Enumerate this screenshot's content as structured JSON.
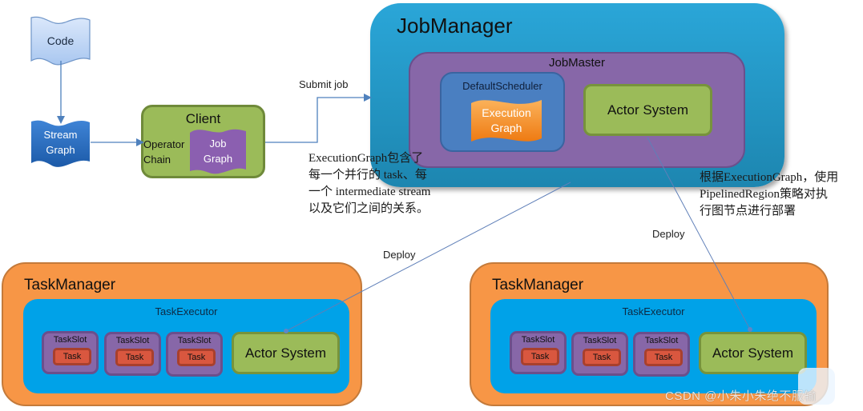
{
  "diagram": {
    "nodes": {
      "code": "Code",
      "stream_graph": [
        "Stream",
        "Graph"
      ],
      "client": {
        "title": "Client",
        "operator_chain": [
          "Operator",
          "Chain"
        ],
        "job_graph": [
          "Job",
          "Graph"
        ]
      },
      "job_manager": {
        "title": "JobManager",
        "job_master": {
          "title": "JobMaster",
          "default_scheduler": {
            "title": "DefaultScheduler",
            "execution_graph": [
              "Execution",
              "Graph"
            ]
          },
          "actor_system": "Actor System"
        }
      },
      "task_managers": [
        {
          "title": "TaskManager",
          "executor": "TaskExecutor",
          "slots": [
            {
              "title": "TaskSlot",
              "task": "Task"
            },
            {
              "title": "TaskSlot",
              "task": "Task"
            },
            {
              "title": "TaskSlot",
              "task": "Task"
            }
          ],
          "actor_system": "Actor System"
        },
        {
          "title": "TaskManager",
          "executor": "TaskExecutor",
          "slots": [
            {
              "title": "TaskSlot",
              "task": "Task"
            },
            {
              "title": "TaskSlot",
              "task": "Task"
            },
            {
              "title": "TaskSlot",
              "task": "Task"
            }
          ],
          "actor_system": "Actor System"
        }
      ]
    },
    "edges": {
      "submit_job": "Submit job",
      "deploy_left": "Deploy",
      "deploy_right": "Deploy"
    },
    "notes": {
      "execution_graph_note": [
        "ExecutionGraph包含了",
        "每一个并行的 task、每",
        "一个 intermediate stream",
        "以及它们之间的关系。"
      ],
      "deploy_note": [
        "根据ExecutionGraph，使用",
        "PipelinedRegion策略对执",
        "行图节点进行部署"
      ]
    },
    "colors": {
      "job_manager": "#2aa6d8",
      "job_master": "#8767a8",
      "scheduler": "#4a7fc1",
      "actor_system": "#9bbb59",
      "task_manager": "#f79646",
      "task_executor": "#00a2e8",
      "task": "#d9573f",
      "arrow": "#4f81bd"
    }
  },
  "watermark": "CSDN @小朱小朱绝不服输"
}
